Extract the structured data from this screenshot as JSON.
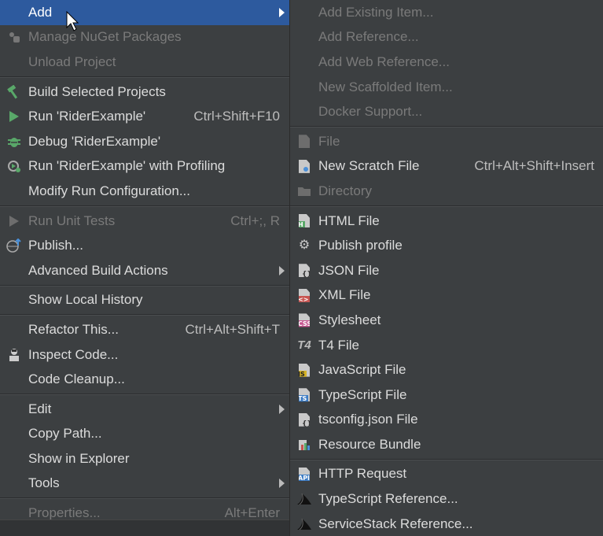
{
  "main_menu": {
    "items": [
      {
        "label": "Add",
        "icon": "none",
        "submenu": true,
        "selected": true
      },
      {
        "label": "Manage NuGet Packages",
        "icon": "nuget-icon",
        "disabled": true
      },
      {
        "label": "Unload Project",
        "icon": "none",
        "disabled": true
      },
      {
        "label": "Build Selected Projects",
        "icon": "hammer-icon"
      },
      {
        "label": "Run 'RiderExample'",
        "icon": "run-icon",
        "shortcut": "Ctrl+Shift+F10"
      },
      {
        "label": "Debug 'RiderExample'",
        "icon": "bug-icon"
      },
      {
        "label": "Run 'RiderExample' with Profiling",
        "icon": "profiling-icon"
      },
      {
        "label": "Modify Run Configuration...",
        "icon": "none"
      },
      {
        "label": "Run Unit Tests",
        "icon": "run-icon",
        "shortcut": "Ctrl+;, R",
        "disabled": true
      },
      {
        "label": "Publish...",
        "icon": "publish-icon"
      },
      {
        "label": "Advanced Build Actions",
        "icon": "none",
        "submenu": true
      },
      {
        "label": "Show Local History",
        "icon": "none"
      },
      {
        "label": "Refactor This...",
        "icon": "none",
        "shortcut": "Ctrl+Alt+Shift+T"
      },
      {
        "label": "Inspect Code...",
        "icon": "inspect-icon"
      },
      {
        "label": "Code Cleanup...",
        "icon": "none"
      },
      {
        "label": "Edit",
        "icon": "none",
        "submenu": true
      },
      {
        "label": "Copy Path...",
        "icon": "none"
      },
      {
        "label": "Show in Explorer",
        "icon": "none"
      },
      {
        "label": "Tools",
        "icon": "none",
        "submenu": true
      },
      {
        "label": "Properties...",
        "icon": "none",
        "shortcut": "Alt+Enter",
        "disabled": true
      }
    ]
  },
  "sub_menu": {
    "items": [
      {
        "label": "Add Existing Item...",
        "disabled": true
      },
      {
        "label": "Add Reference...",
        "disabled": true
      },
      {
        "label": "Add Web Reference...",
        "disabled": true
      },
      {
        "label": "New Scaffolded Item...",
        "disabled": true
      },
      {
        "label": "Docker Support...",
        "disabled": true
      },
      {
        "label": "File",
        "icon": "file-icon",
        "disabled": true
      },
      {
        "label": "New Scratch File",
        "icon": "scratch-file-icon",
        "shortcut": "Ctrl+Alt+Shift+Insert"
      },
      {
        "label": "Directory",
        "icon": "folder-icon",
        "disabled": true
      },
      {
        "label": "HTML File",
        "icon": "html-file-icon",
        "tag": "H"
      },
      {
        "label": "Publish profile",
        "icon": "gear-icon"
      },
      {
        "label": "JSON File",
        "icon": "json-file-icon"
      },
      {
        "label": "XML File",
        "icon": "xml-file-icon",
        "tag": "<>"
      },
      {
        "label": "Stylesheet",
        "icon": "css-file-icon",
        "tag": "CSS"
      },
      {
        "label": "T4 File",
        "icon": "t4-icon",
        "tag": "T4"
      },
      {
        "label": "JavaScript File",
        "icon": "js-file-icon",
        "tag": "JS"
      },
      {
        "label": "TypeScript File",
        "icon": "ts-file-icon",
        "tag": "TS"
      },
      {
        "label": "tsconfig.json File",
        "icon": "tsconfig-file-icon"
      },
      {
        "label": "Resource Bundle",
        "icon": "resource-bundle-icon"
      },
      {
        "label": "HTTP Request",
        "icon": "http-request-icon",
        "tag": "API"
      },
      {
        "label": "TypeScript Reference...",
        "icon": "servicestack-icon"
      },
      {
        "label": "ServiceStack Reference...",
        "icon": "servicestack-icon"
      }
    ]
  },
  "colors": {
    "selected": "#2d5a9e",
    "menu_bg": "#3c3f41",
    "disabled_text": "#7a7a7a"
  }
}
